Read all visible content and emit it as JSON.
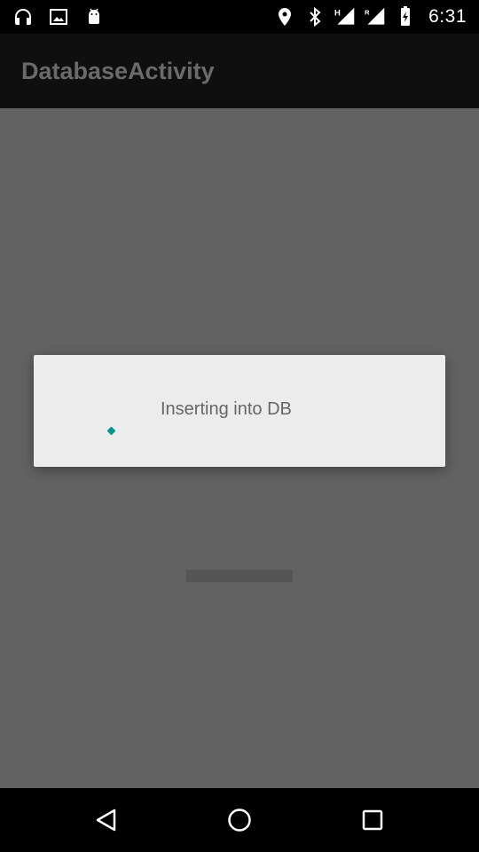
{
  "status_bar": {
    "time": "6:31",
    "network_type_label": "H",
    "roaming_label": "R",
    "left_icons": [
      "headphones-icon",
      "image-icon",
      "android-icon"
    ],
    "right_icons": [
      "location-icon",
      "bluetooth-icon",
      "signal-icon",
      "roaming-signal-icon",
      "battery-charging-icon"
    ]
  },
  "app_bar": {
    "title": "DatabaseActivity"
  },
  "dialog": {
    "message": "Inserting into DB",
    "spinner_color": "#009688"
  },
  "nav_bar": {
    "buttons": [
      "back-icon",
      "home-icon",
      "recents-icon"
    ]
  },
  "colors": {
    "scrim": "#626262",
    "dialog_background": "#ececec",
    "app_bar_background": "#0f0f0f",
    "accent": "#009688"
  }
}
